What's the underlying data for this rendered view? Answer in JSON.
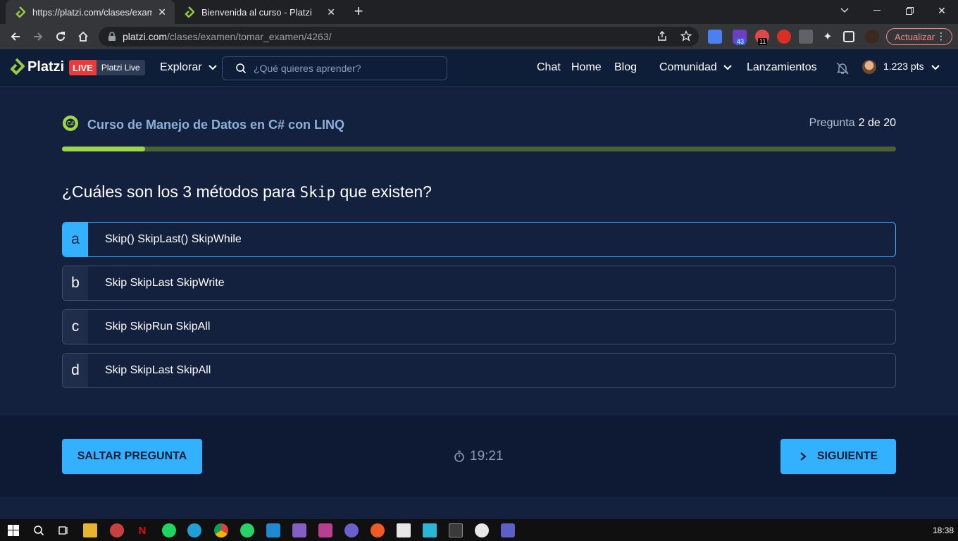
{
  "browser": {
    "tabs": [
      {
        "title": "https://platzi.com/clases/examen/",
        "active": true
      },
      {
        "title": "Bienvenida al curso - Platzi",
        "active": false
      }
    ],
    "url_host": "platzi.com",
    "url_path": "/clases/examen/tomar_examen/4263/",
    "update_label": "Actualizar",
    "ext_badges": {
      "count1": "43",
      "count2": "11"
    }
  },
  "header": {
    "logo": "Platzi",
    "live": "LIVE",
    "platzi_live": "Platzi Live",
    "explorar": "Explorar",
    "search_placeholder": "¿Qué quieres aprender?",
    "links": [
      "Chat",
      "Home",
      "Blog"
    ],
    "comunidad": "Comunidad",
    "lanzamientos": "Lanzamientos",
    "points": "1.223 pts"
  },
  "exam": {
    "course_title": "Curso de Manejo de Datos en C# con LINQ",
    "question_label": "Pregunta",
    "question_number": "2 de 20",
    "progress": 0.1,
    "question_prefix": "¿Cuáles son los 3 métodos para ",
    "question_code": "Skip",
    "question_suffix": " que existen?",
    "options": [
      {
        "letter": "a",
        "text": "Skip() SkipLast() SkipWhile",
        "selected": true
      },
      {
        "letter": "b",
        "text": "Skip SkipLast SkipWrite",
        "selected": false
      },
      {
        "letter": "c",
        "text": "Skip SkipRun SkipAll",
        "selected": false
      },
      {
        "letter": "d",
        "text": "Skip SkipLast SkipAll",
        "selected": false
      }
    ]
  },
  "footer": {
    "skip_label": "SALTAR PREGUNTA",
    "timer": "19:21",
    "next_label": "SIGUIENTE"
  },
  "taskbar": {
    "time": "18:38"
  },
  "colors": {
    "accent": "#33b1ff",
    "brand_green": "#9dd54a",
    "background": "#13213f",
    "live_red": "#ea3a3a"
  }
}
